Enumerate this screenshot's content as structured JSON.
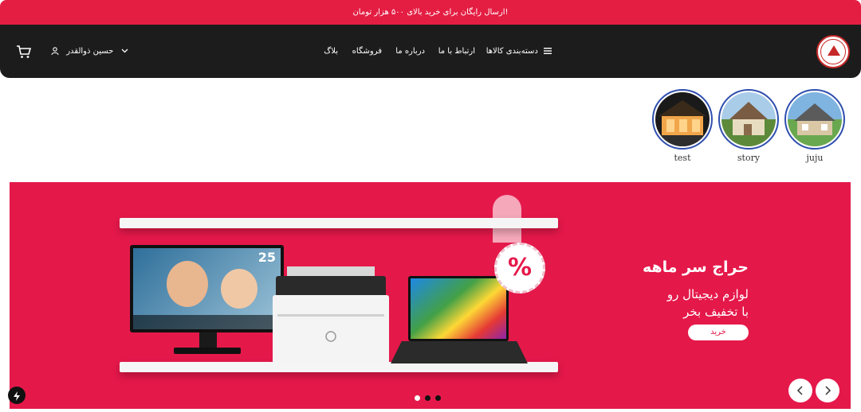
{
  "announcement": {
    "text": "ارسال رایگان برای خرید بالای ۵۰۰ هزار تومان!"
  },
  "header": {
    "menu": [
      {
        "label": "دسته‌بندی کالاها"
      },
      {
        "label": "ارتباط با ما"
      },
      {
        "label": "درباره ما"
      },
      {
        "label": "فروشگاه"
      },
      {
        "label": "بلاگ"
      }
    ],
    "user": {
      "name": "حسین ذوالقدر"
    },
    "icons": {
      "logo": "brand-logo",
      "menu": "hamburger-icon",
      "user": "user-icon",
      "chevron": "chevron-down-icon",
      "cart": "cart-icon"
    }
  },
  "stories": [
    {
      "label": "juju"
    },
    {
      "label": "story"
    },
    {
      "label": "test"
    }
  ],
  "banner": {
    "title": "حراج سر ماهه",
    "line1": "لوازم دیجیتال رو",
    "line2": "با تخفیف بخر",
    "button": "خرید",
    "monitor_number": "25",
    "tag_symbol": "%",
    "background_color": "#e5184a",
    "slides": 3,
    "active_slide": 1
  },
  "colors": {
    "topbar": "#e41e43",
    "navbar": "#1c1c1c",
    "story_ring": "#2f4fae"
  }
}
